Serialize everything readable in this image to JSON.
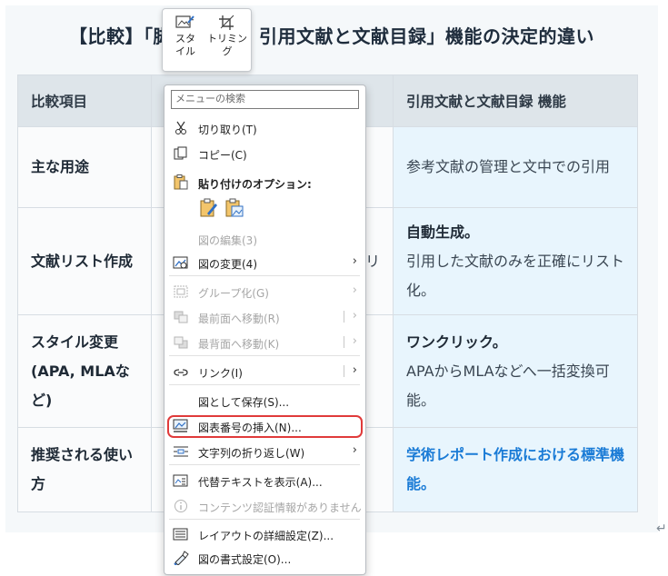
{
  "document": {
    "title": "【比較】「脚注・文末脚注」と「引用文献と文献目録」機能の決定的違い",
    "title_visible_left": "【比較】「脚",
    "title_visible_right": "引用文献と文献目録」機能の決定的違い",
    "table": {
      "headers": [
        "比較項目",
        "",
        "引用文献と文献目録 機能"
      ],
      "rows": [
        {
          "item": "主な用途",
          "col2": "",
          "col3": "参考文献の管理と文中での引用",
          "col3_strong": ""
        },
        {
          "item": "文献リスト作成",
          "col2": "リ",
          "col3_strong": "自動生成。",
          "col3": "引用した文献のみを正確にリスト化。"
        },
        {
          "item": "スタイル変更 (APA, MLAなど)",
          "col2": "",
          "col3_strong": "ワンクリック。",
          "col3": "APAからMLAなどへ一括変換可能。"
        },
        {
          "item": "推奨される使い方",
          "col2": "",
          "col3_strong": "",
          "col3_link": "学術レポート作成における標準機能。",
          "col3": ""
        }
      ]
    },
    "paragraph_mark": "↵"
  },
  "mini_toolbar": {
    "style_label": "スタイル",
    "trim_label": "トリミング"
  },
  "context_menu": {
    "search_placeholder": "メニューの検索",
    "items": [
      {
        "label": "切り取り(T)",
        "icon": "scissors-icon",
        "enabled": true
      },
      {
        "label": "コピー(C)",
        "icon": "copy-icon",
        "enabled": true
      },
      {
        "label": "貼り付けのオプション:",
        "icon": "paste-icon",
        "enabled": true
      },
      {
        "label": "図の編集(3)",
        "icon": "",
        "enabled": false
      },
      {
        "label": "図の変更(4)",
        "icon": "change-picture-icon",
        "enabled": true,
        "submenu": true
      },
      {
        "label": "グループ化(G)",
        "icon": "group-icon",
        "enabled": false,
        "submenu": true
      },
      {
        "label": "最前面へ移動(R)",
        "icon": "bring-front-icon",
        "enabled": false,
        "submenu": true
      },
      {
        "label": "最背面へ移動(K)",
        "icon": "send-back-icon",
        "enabled": false,
        "submenu": true
      },
      {
        "label": "リンク(I)",
        "icon": "link-icon",
        "enabled": true,
        "submenu": true
      },
      {
        "label": "図として保存(S)...",
        "icon": "",
        "enabled": true
      },
      {
        "label": "図表番号の挿入(N)...",
        "icon": "insert-caption-icon",
        "enabled": true,
        "highlighted": true
      },
      {
        "label": "文字列の折り返し(W)",
        "icon": "wrap-text-icon",
        "enabled": true,
        "submenu": true
      },
      {
        "label": "代替テキストを表示(A)...",
        "icon": "alt-text-icon",
        "enabled": true
      },
      {
        "label": "コンテンツ認証情報がありません",
        "icon": "info-icon",
        "enabled": false
      },
      {
        "label": "レイアウトの詳細設定(Z)...",
        "icon": "layout-icon",
        "enabled": true
      },
      {
        "label": "図の書式設定(O)...",
        "icon": "format-picture-icon",
        "enabled": true
      }
    ]
  },
  "colors": {
    "highlight_border": "#e03a3a",
    "link_blue": "#1a7bd6",
    "cell_blue": "#e8f5fd"
  }
}
